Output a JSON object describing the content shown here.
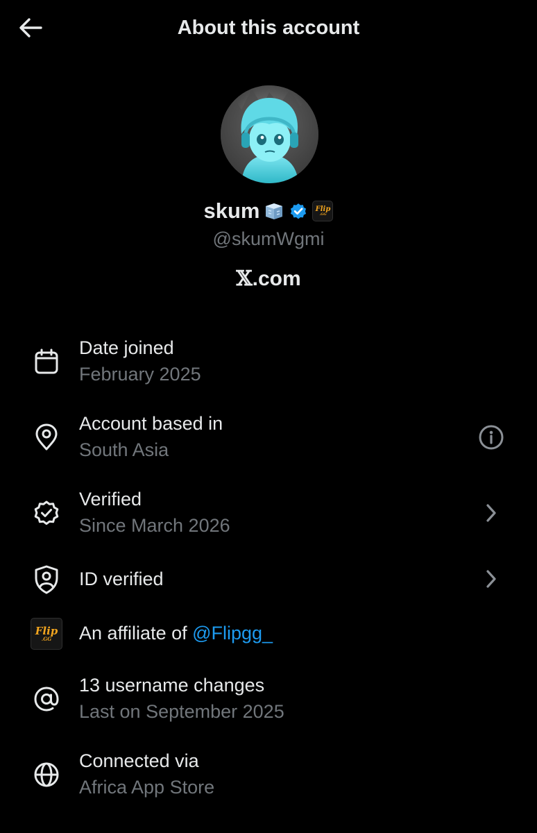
{
  "header": {
    "title": "About this account",
    "back_icon": "arrow-left-icon"
  },
  "profile": {
    "display_name": "skum",
    "emoji_icon": "ice-cube-icon",
    "verified_icon": "verified-badge-icon",
    "affiliate_badge_text": "Flip",
    "affiliate_badge_sub": ".GG",
    "handle": "@skumWgmi",
    "site_mark": "𝕏",
    "site_suffix": ".com"
  },
  "rows": {
    "date_joined": {
      "title": "Date joined",
      "subtitle": "February 2025",
      "icon": "calendar-icon"
    },
    "based_in": {
      "title": "Account based in",
      "subtitle": "South Asia",
      "icon": "location-pin-icon",
      "action_icon": "info-icon"
    },
    "verified": {
      "title": "Verified",
      "subtitle": "Since March 2026",
      "icon": "verified-check-icon",
      "action_icon": "chevron-right-icon"
    },
    "id_verified": {
      "title": "ID verified",
      "icon": "shield-user-icon",
      "action_icon": "chevron-right-icon"
    },
    "affiliate": {
      "prefix": "An affiliate of ",
      "link": "@Flipgg_",
      "badge_text": "Flip",
      "badge_sub": ".GG"
    },
    "username_changes": {
      "title": "13 username changes",
      "subtitle": "Last on September 2025",
      "icon": "at-sign-icon"
    },
    "connected_via": {
      "title": "Connected via",
      "subtitle": "Africa App Store",
      "icon": "globe-icon"
    }
  },
  "colors": {
    "background": "#000000",
    "primary_text": "#e7e9ea",
    "secondary_text": "#71767b",
    "link": "#1d9bf0",
    "verified_blue": "#1d9bf0",
    "flip_gold": "#f2a51f"
  }
}
